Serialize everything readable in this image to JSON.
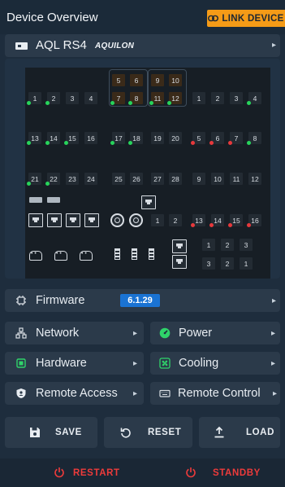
{
  "header": {
    "title": "Device Overview",
    "link_label": "LINK DEVICE",
    "link_icon": "link-icon",
    "accent": "#f59b17"
  },
  "device": {
    "name": "AQL RS4",
    "brand": "AQUILON"
  },
  "chassis": {
    "top_left_ports": [
      "1",
      "2",
      "3",
      "4"
    ],
    "top_orange_group_a": [
      "5",
      "6",
      "7",
      "8"
    ],
    "top_orange_group_b": [
      "9",
      "10",
      "11",
      "12"
    ],
    "top_right_ports": [
      "1",
      "2",
      "3",
      "4"
    ],
    "mid_left": [
      "13",
      "14",
      "15",
      "16"
    ],
    "mid_center": [
      "17",
      "18",
      "19",
      "20"
    ],
    "mid_right": [
      "5",
      "6",
      "7",
      "8"
    ],
    "low_left": [
      "21",
      "22",
      "23",
      "24"
    ],
    "low_center": [
      "25",
      "26",
      "27",
      "28"
    ],
    "low_right": [
      "9",
      "10",
      "11",
      "12"
    ],
    "coax_row_nums": [
      "1",
      "2"
    ],
    "red_row": [
      "13",
      "14",
      "15",
      "16"
    ],
    "small_grid_top": [
      "1",
      "2",
      "3"
    ],
    "small_grid_bottom": [
      "3",
      "2",
      "1"
    ],
    "led_green": "#27d45b",
    "led_red": "#e6393c"
  },
  "menu": {
    "firmware": {
      "label": "Firmware",
      "version": "6.1.29"
    },
    "network": {
      "label": "Network"
    },
    "power": {
      "label": "Power"
    },
    "hardware": {
      "label": "Hardware"
    },
    "cooling": {
      "label": "Cooling"
    },
    "remote_access": {
      "label": "Remote Access"
    },
    "remote_control": {
      "label": "Remote Control"
    }
  },
  "actions": {
    "save": "SAVE",
    "reset": "RESET",
    "load": "LOAD",
    "restart": "RESTART",
    "standby": "STANDBY"
  },
  "colors": {
    "green_icon": "#2fd36a",
    "danger": "#ee3b3b",
    "badge": "#1a73d3"
  }
}
